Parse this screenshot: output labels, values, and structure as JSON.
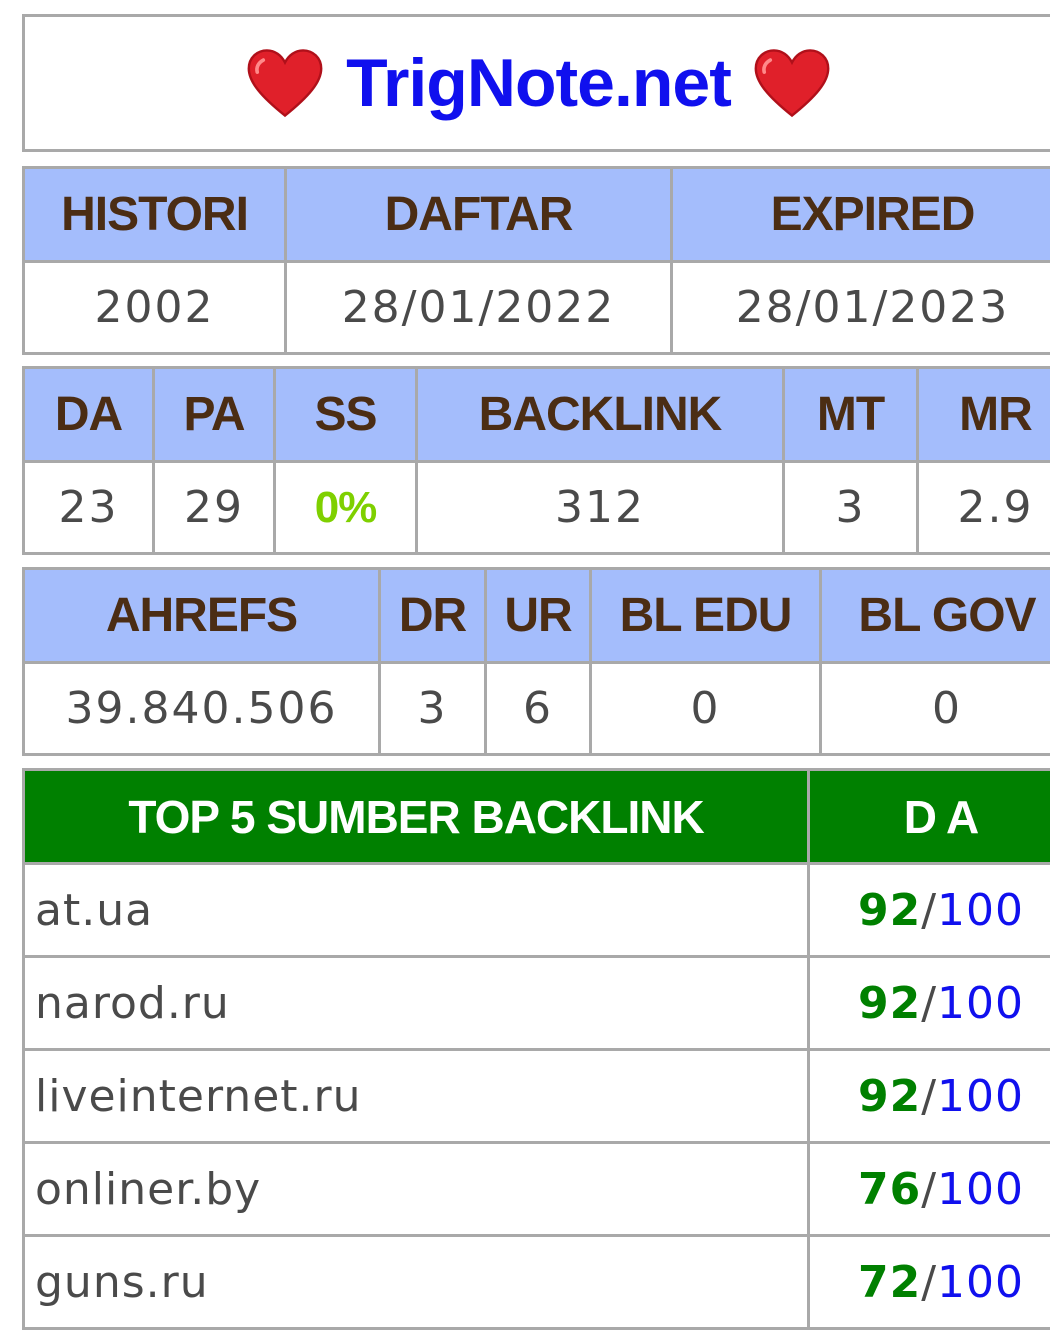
{
  "header": {
    "site": "TrigNote.net",
    "heart_color": "#e0202a"
  },
  "dates": {
    "headers": [
      "HISTORI",
      "DAFTAR",
      "EXPIRED"
    ],
    "values": [
      "2002",
      "28/01/2022",
      "28/01/2023"
    ]
  },
  "moz": {
    "headers": [
      "DA",
      "PA",
      "SS",
      "BACKLINK",
      "MT",
      "MR"
    ],
    "values": [
      "23",
      "29",
      "0%",
      "312",
      "3",
      "2.9"
    ]
  },
  "ahrefs": {
    "headers": [
      "AHREFS",
      "DR",
      "UR",
      "BL EDU",
      "BL GOV"
    ],
    "values": [
      "39.840.506",
      "3",
      "6",
      "0",
      "0"
    ]
  },
  "top": {
    "headers": [
      "TOP 5 SUMBER BACKLINK",
      "D A"
    ],
    "rows": [
      {
        "source": "at.ua",
        "score": "92",
        "sep": "/",
        "max": "100"
      },
      {
        "source": "narod.ru",
        "score": "92",
        "sep": "/",
        "max": "100"
      },
      {
        "source": "liveinternet.ru",
        "score": "92",
        "sep": "/",
        "max": "100"
      },
      {
        "source": "onliner.by",
        "score": "76",
        "sep": "/",
        "max": "100"
      },
      {
        "source": "guns.ru",
        "score": "72",
        "sep": "/",
        "max": "100"
      }
    ]
  }
}
